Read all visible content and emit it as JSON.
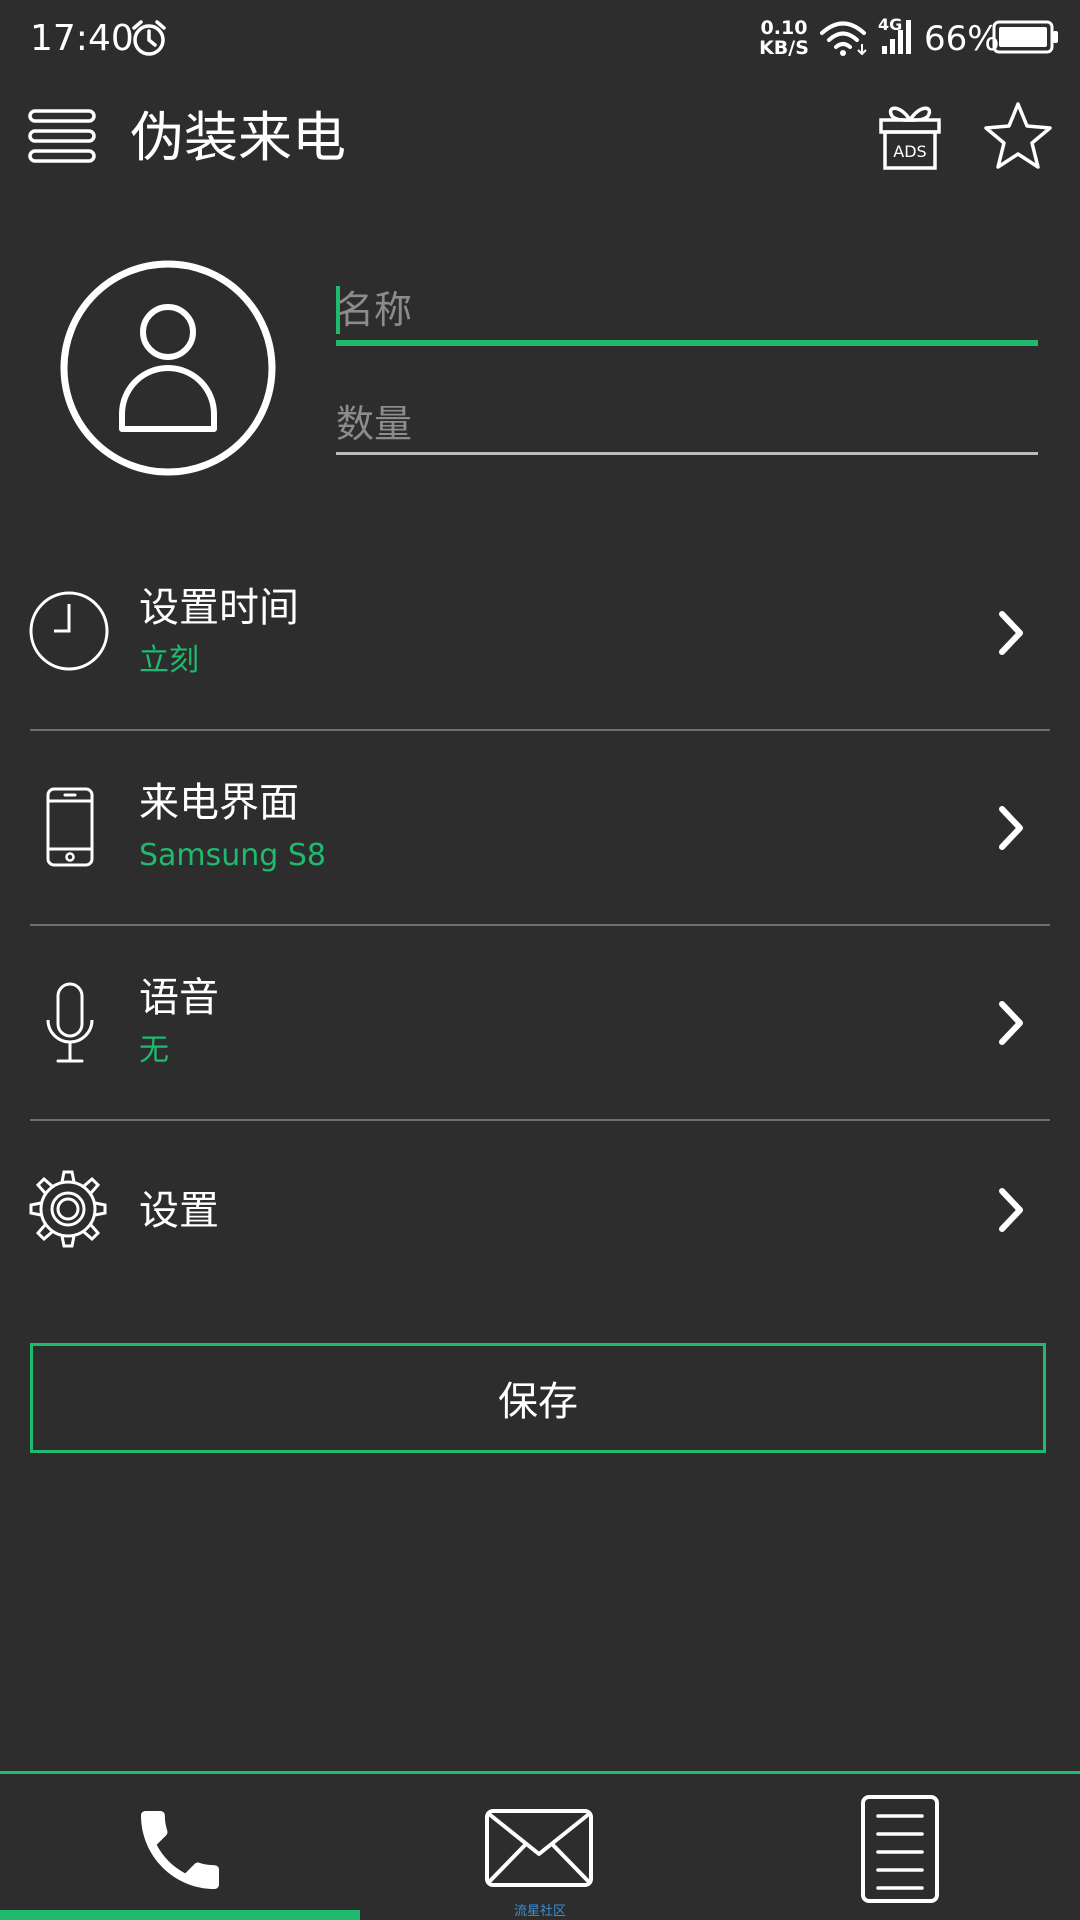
{
  "status_bar": {
    "time": "17:40",
    "speed_value": "0.10",
    "speed_unit": "KB/S",
    "network": "4G",
    "battery": "66%"
  },
  "app_bar": {
    "title": "伪装来电",
    "ads_badge": "ADS"
  },
  "form": {
    "name_placeholder": "名称",
    "count_placeholder": "数量"
  },
  "settings": [
    {
      "title": "设置时间",
      "value": "立刻"
    },
    {
      "title": "来电界面",
      "value": "Samsung S8"
    },
    {
      "title": "语音",
      "value": "无"
    },
    {
      "title": "设置"
    }
  ],
  "save_label": "保存",
  "bottom_nav": {
    "watermark": "流星社区"
  },
  "colors": {
    "background": "#2d2d2d",
    "accent": "#1fba6e",
    "divider": "#6e6e6e"
  }
}
